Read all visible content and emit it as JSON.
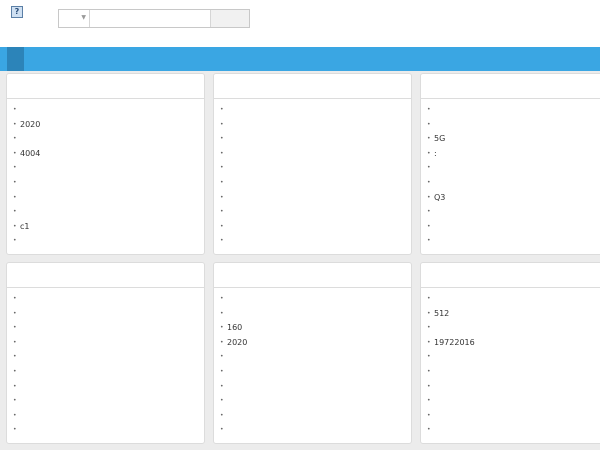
{
  "header": {
    "logo_glyph": "?",
    "search": {
      "value": "",
      "placeholder": ""
    }
  },
  "panels": [
    {
      "items": [
        "",
        "2020",
        "",
        "4004",
        "",
        "",
        "",
        "",
        "c1",
        ""
      ]
    },
    {
      "items": [
        "",
        "",
        "",
        "",
        "",
        "",
        "",
        "",
        "",
        ""
      ]
    },
    {
      "items": [
        "",
        "",
        "5G",
        ":",
        "",
        "",
        " Q3",
        "",
        "",
        ""
      ]
    },
    {
      "items": [
        "",
        "",
        "",
        "",
        "",
        "",
        "",
        "",
        "",
        ""
      ]
    },
    {
      "items": [
        "",
        "",
        "160",
        "2020",
        "",
        "",
        "",
        "",
        "",
        ""
      ]
    },
    {
      "items": [
        "",
        "512",
        "",
        "19722016",
        "",
        "",
        "",
        "",
        "",
        ""
      ]
    }
  ],
  "colors": {
    "nav": "#3aa6e3",
    "nav_active": "#2c84b9"
  }
}
